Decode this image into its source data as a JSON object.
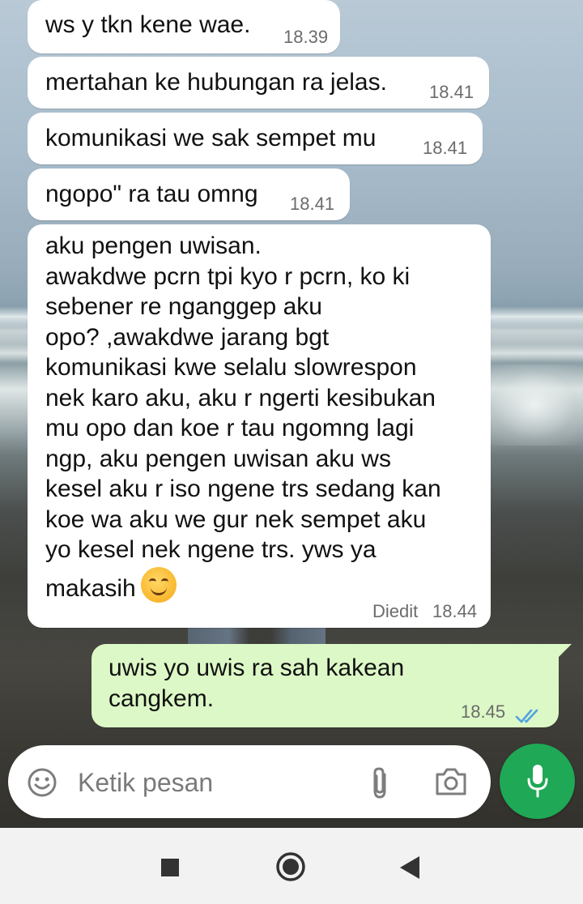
{
  "messages": [
    {
      "text": "ws y tkn kene wae.",
      "time": "18.39"
    },
    {
      "text": "mertahan ke hubungan ra jelas.",
      "time": "18.41"
    },
    {
      "text": "komunikasi we sak sempet mu",
      "time": "18.41"
    },
    {
      "text": "ngopo\" ra tau omng",
      "time": "18.41"
    },
    {
      "lines": [
        "aku pengen uwisan.",
        "awakdwe pcrn tpi kyo r pcrn, ko ki",
        "sebener re nganggep aku",
        "opo? ,awakdwe  jarang bgt",
        "komunikasi kwe selalu slowrespon",
        "nek karo aku, aku r ngerti kesibukan",
        "mu opo dan koe r tau ngomng lagi",
        "ngp, aku pengen uwisan aku ws",
        "kesel aku r iso ngene trs sedang kan",
        "koe wa aku we gur nek sempet aku",
        "yo kesel nek ngene trs. yws ya",
        "makasih"
      ],
      "emoji": "smiling-face-emoji",
      "edited_label": "Diedit",
      "time": "18.44"
    }
  ],
  "outgoing": {
    "lines": [
      "uwis yo uwis ra sah kakean",
      "cangkem."
    ],
    "time": "18.45",
    "status_icon": "double-check-read-icon",
    "status_color": "#4fa3e0"
  },
  "composer": {
    "placeholder": "Ketik pesan",
    "icons": [
      "emoji-icon",
      "attach-icon",
      "camera-icon"
    ],
    "send_icon": "mic-icon",
    "accent": "#1fa855"
  },
  "navbar": {
    "icons": [
      "recents-icon",
      "home-icon",
      "back-icon"
    ]
  },
  "colors": {
    "incoming_bubble": "#ffffff",
    "outgoing_bubble": "#dcf8c6"
  }
}
